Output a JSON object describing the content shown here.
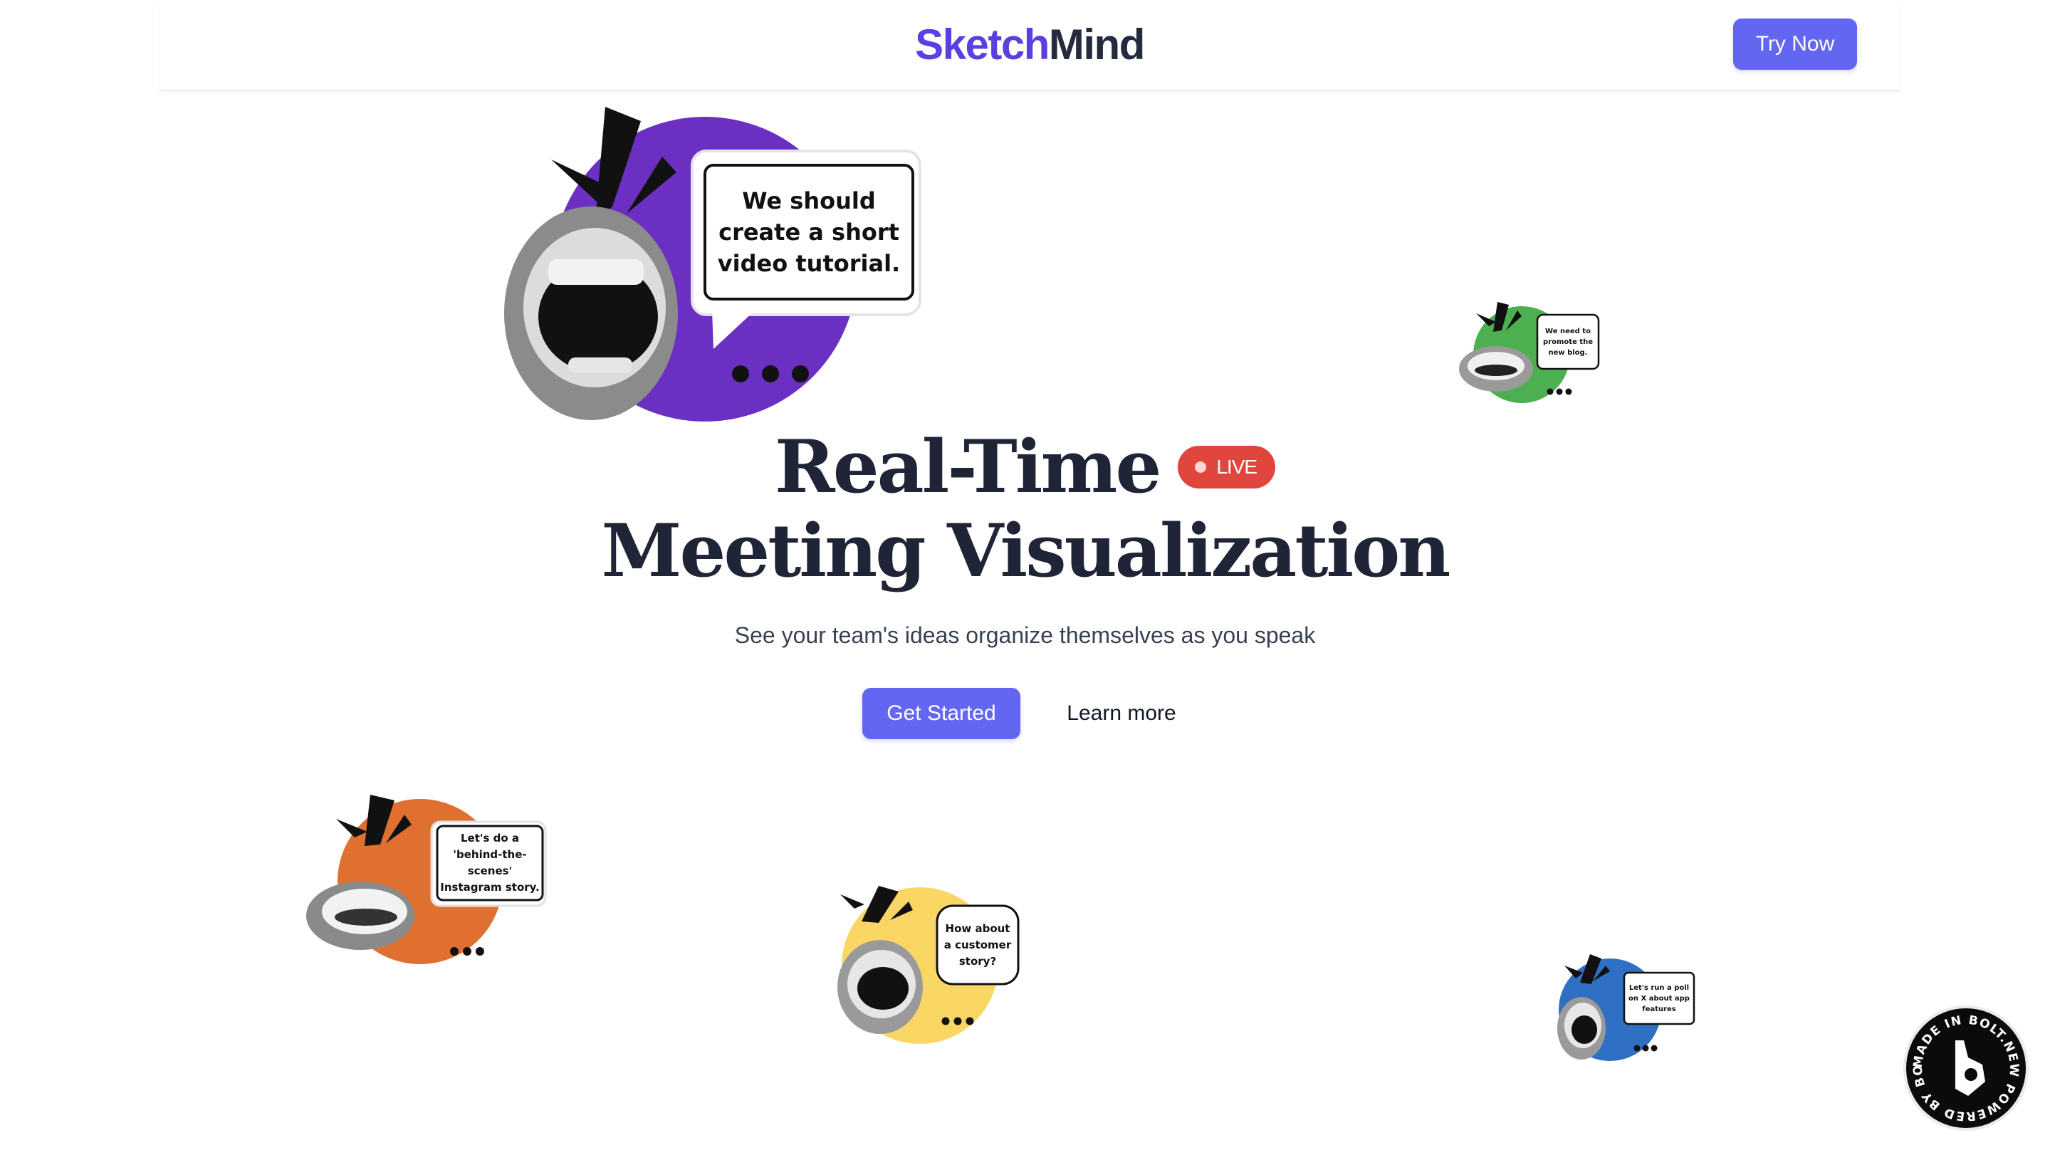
{
  "header": {
    "logo_part1": "Sketch",
    "logo_part2": "Mind",
    "cta_label": "Try Now"
  },
  "hero": {
    "title_line1": "Real-Time",
    "title_line2": "Meeting Visualization",
    "live_label": "LIVE",
    "subtitle": "See your team's ideas organize themselves as you speak",
    "primary_button": "Get Started",
    "secondary_link": "Learn more"
  },
  "bubbles": [
    {
      "text": "We should create a short video tutorial.",
      "color": "#6b2fc1"
    },
    {
      "text": "We need to promote the new blog.",
      "color": "#4caf50"
    },
    {
      "text": "Let's do a 'behind-the-scenes' Instagram story.",
      "color": "#e0702f"
    },
    {
      "text": "How about a customer story?",
      "color": "#fad765"
    },
    {
      "text": "Let's run a poll on X about app features",
      "color": "#2f6fc4"
    }
  ],
  "badge": {
    "text": "MADE IN BOLT.NEW POWERED BY BOLT.NEW"
  },
  "colors": {
    "accent": "#6366f1",
    "brand_purple": "#5b3fe0",
    "live_red": "#e0463e"
  }
}
